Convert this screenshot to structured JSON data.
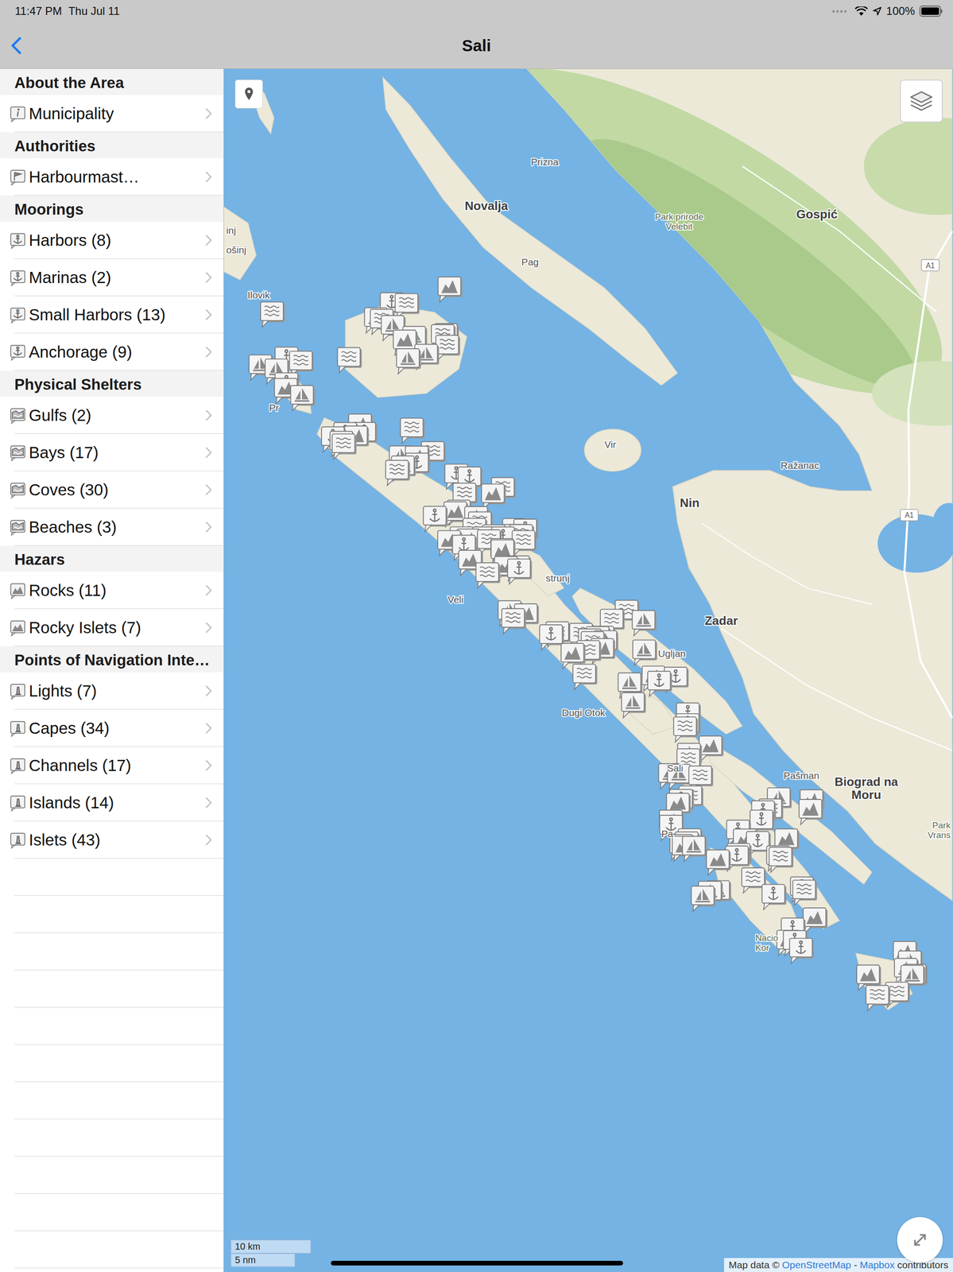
{
  "status_bar": {
    "time": "11:47 PM",
    "date": "Thu Jul 11",
    "battery": "100%",
    "battery_level": 1
  },
  "nav": {
    "title": "Sali"
  },
  "sidebar": {
    "sections": [
      {
        "title": "About the Area",
        "items": [
          {
            "label": "Municipality"
          }
        ]
      },
      {
        "title": "Authorities",
        "items": [
          {
            "label": "Harbourmast…"
          }
        ]
      },
      {
        "title": "Moorings",
        "items": [
          {
            "label": "Harbors (8)"
          },
          {
            "label": "Marinas (2)"
          },
          {
            "label": "Small Harbors (13)"
          },
          {
            "label": "Anchorage (9)"
          }
        ]
      },
      {
        "title": "Physical Shelters",
        "items": [
          {
            "label": "Gulfs (2)"
          },
          {
            "label": "Bays (17)"
          },
          {
            "label": "Coves (30)"
          },
          {
            "label": "Beaches (3)"
          }
        ]
      },
      {
        "title": "Hazars",
        "items": [
          {
            "label": "Rocks (11)"
          },
          {
            "label": "Rocky Islets (7)"
          }
        ]
      },
      {
        "title": "Points of Navigation Inte…",
        "items": [
          {
            "label": "Lights (7)"
          },
          {
            "label": "Capes (34)"
          },
          {
            "label": "Channels (17)"
          },
          {
            "label": "Islands (14)"
          },
          {
            "label": "Islets (43)"
          }
        ]
      }
    ]
  },
  "map": {
    "labels": [
      {
        "lines": [
          "Prizna"
        ],
        "kind": "town"
      },
      {
        "lines": [
          "Novalja"
        ],
        "kind": "city"
      },
      {
        "lines": [
          "Park prirode",
          "Velebit"
        ],
        "kind": "park"
      },
      {
        "lines": [
          "Gospić"
        ],
        "kind": "city"
      },
      {
        "lines": [
          "Pag"
        ],
        "kind": "town"
      },
      {
        "lines": [
          "Ilovik"
        ],
        "kind": "town"
      },
      {
        "lines": [
          "inj"
        ],
        "kind": "town"
      },
      {
        "lines": [
          "ošinj"
        ],
        "kind": "town"
      },
      {
        "lines": [
          "Vir"
        ],
        "kind": "town"
      },
      {
        "lines": [
          "Ražanac"
        ],
        "kind": "town"
      },
      {
        "lines": [
          "Nin"
        ],
        "kind": "city"
      },
      {
        "lines": [
          "Zadar"
        ],
        "kind": "city"
      },
      {
        "lines": [
          "Ugljan"
        ],
        "kind": "town"
      },
      {
        "lines": [
          "Pašman"
        ],
        "kind": "town"
      },
      {
        "lines": [
          "Biograd na",
          "Moru"
        ],
        "kind": "city"
      },
      {
        "lines": [
          "Park",
          "Vrans"
        ],
        "kind": "park"
      },
      {
        "lines": [
          "Pr"
        ],
        "kind": "town"
      },
      {
        "lines": [
          "strunj"
        ],
        "kind": "town"
      },
      {
        "lines": [
          "Veli"
        ],
        "kind": "town"
      },
      {
        "lines": [
          "Dugi Otok"
        ],
        "kind": "town"
      },
      {
        "lines": [
          "Sali"
        ],
        "kind": "town"
      },
      {
        "lines": [
          "Pa"
        ],
        "kind": "town"
      },
      {
        "lines": [
          "Nacio",
          "Kor"
        ],
        "kind": "park"
      }
    ],
    "road_shields": [
      "A1",
      "A1"
    ],
    "scale": [
      "10 km",
      "5 nm"
    ],
    "attribution": {
      "prefix": "Map data ©",
      "links": [
        "OpenStreetMap",
        "Mapbox"
      ],
      "separator": "-",
      "suffix": "contributors"
    }
  }
}
